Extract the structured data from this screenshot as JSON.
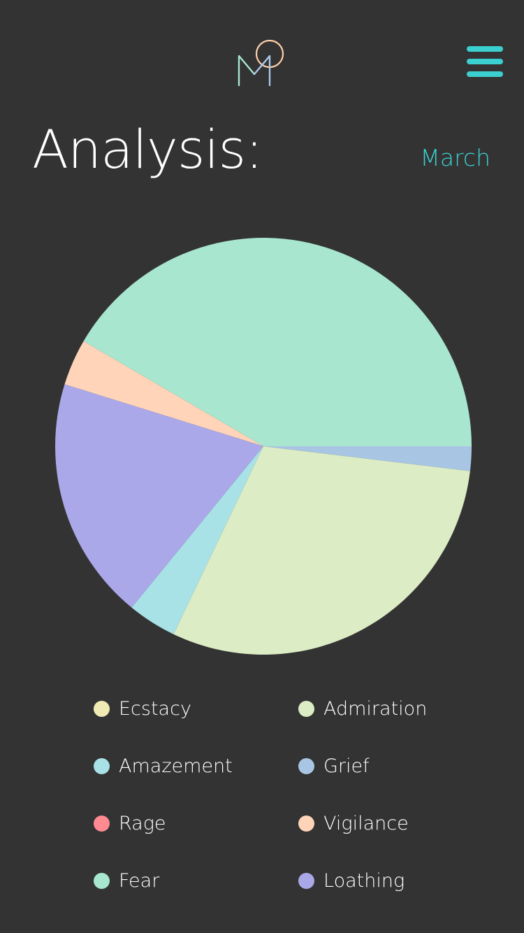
{
  "header": {
    "logo_icon": "monogram-mo-logo-icon",
    "menu_icon": "hamburger-menu-icon",
    "accent_color": "#3ccfcf"
  },
  "page": {
    "title": "Analysis:",
    "month": "March",
    "background": "#333333"
  },
  "chart_data": {
    "type": "pie",
    "unit": "percent",
    "start_angle_deg": 0,
    "direction": "counterclockwise",
    "series": [
      {
        "name": "Ecstacy",
        "value": 0,
        "color": "#f0ebb4"
      },
      {
        "name": "Admiration",
        "value": 30.2,
        "color": "#dcecc4"
      },
      {
        "name": "Amazement",
        "value": 3.8,
        "color": "#a8e2e6"
      },
      {
        "name": "Grief",
        "value": 1.9,
        "color": "#a8c6e4"
      },
      {
        "name": "Rage",
        "value": 0,
        "color": "#ff8a92"
      },
      {
        "name": "Vigilance",
        "value": 3.6,
        "color": "#ffd4b8"
      },
      {
        "name": "Fear",
        "value": 41.6,
        "color": "#a8e6cf"
      },
      {
        "name": "Loathing",
        "value": 18.9,
        "color": "#aaa8e8"
      }
    ],
    "slice_order": [
      "Fear",
      "Vigilance",
      "Loathing",
      "Amazement",
      "Admiration",
      "Grief"
    ],
    "legend": {
      "placement": "bottom",
      "columns": 2,
      "order": [
        "Ecstacy",
        "Admiration",
        "Amazement",
        "Grief",
        "Rage",
        "Vigilance",
        "Fear",
        "Loathing"
      ]
    }
  }
}
